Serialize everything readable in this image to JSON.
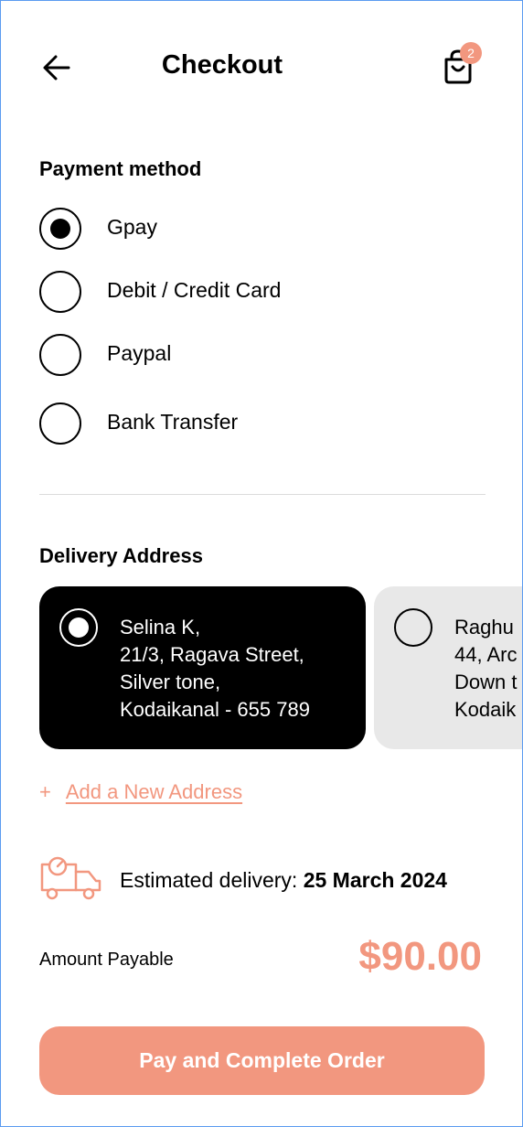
{
  "header": {
    "title": "Checkout",
    "cart_count": "2"
  },
  "payment": {
    "section_title": "Payment method",
    "options": [
      {
        "label": "Gpay",
        "selected": true
      },
      {
        "label": "Debit / Credit Card",
        "selected": false
      },
      {
        "label": "Paypal",
        "selected": false
      },
      {
        "label": "Bank Transfer",
        "selected": false
      }
    ]
  },
  "delivery_address": {
    "section_title": "Delivery Address",
    "addresses": [
      {
        "lines": [
          "Selina K,",
          "21/3, Ragava Street,",
          "Silver tone,",
          "Kodaikanal - 655 789"
        ],
        "selected": true
      },
      {
        "lines": [
          "Raghu",
          "44, Arc",
          "Down t",
          "Kodaik"
        ],
        "selected": false
      }
    ],
    "add_plus": "+",
    "add_label": "Add a New Address"
  },
  "delivery_estimate": {
    "label": "Estimated delivery:",
    "date": "25 March 2024"
  },
  "amount": {
    "label": "Amount Payable",
    "value": "$90.00"
  },
  "pay_button": {
    "label": "Pay and Complete Order"
  },
  "colors": {
    "accent": "#f2977f",
    "card_selected": "#000000",
    "card_other": "#e8e8e8",
    "frame_border": "#5b9bf0"
  },
  "icons": {
    "back": "arrow-left-icon",
    "cart": "shopping-bag-icon",
    "truck": "delivery-truck-icon"
  }
}
